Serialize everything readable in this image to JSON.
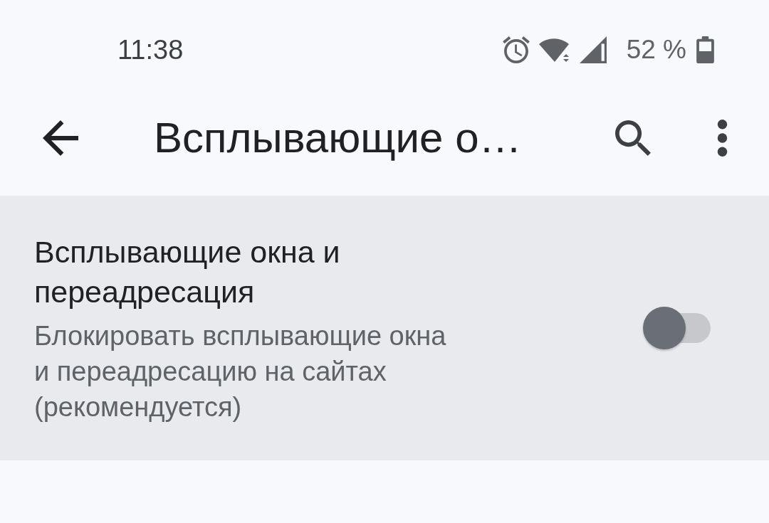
{
  "status_bar": {
    "time": "11:38",
    "battery": "52 %"
  },
  "toolbar": {
    "title": "Всплывающие о…"
  },
  "setting": {
    "title": "Всплывающие окна и переадресация",
    "summary": "Блокировать всплывающие окна и переадресацию на сайтах (рекомендуется)",
    "on": false
  }
}
